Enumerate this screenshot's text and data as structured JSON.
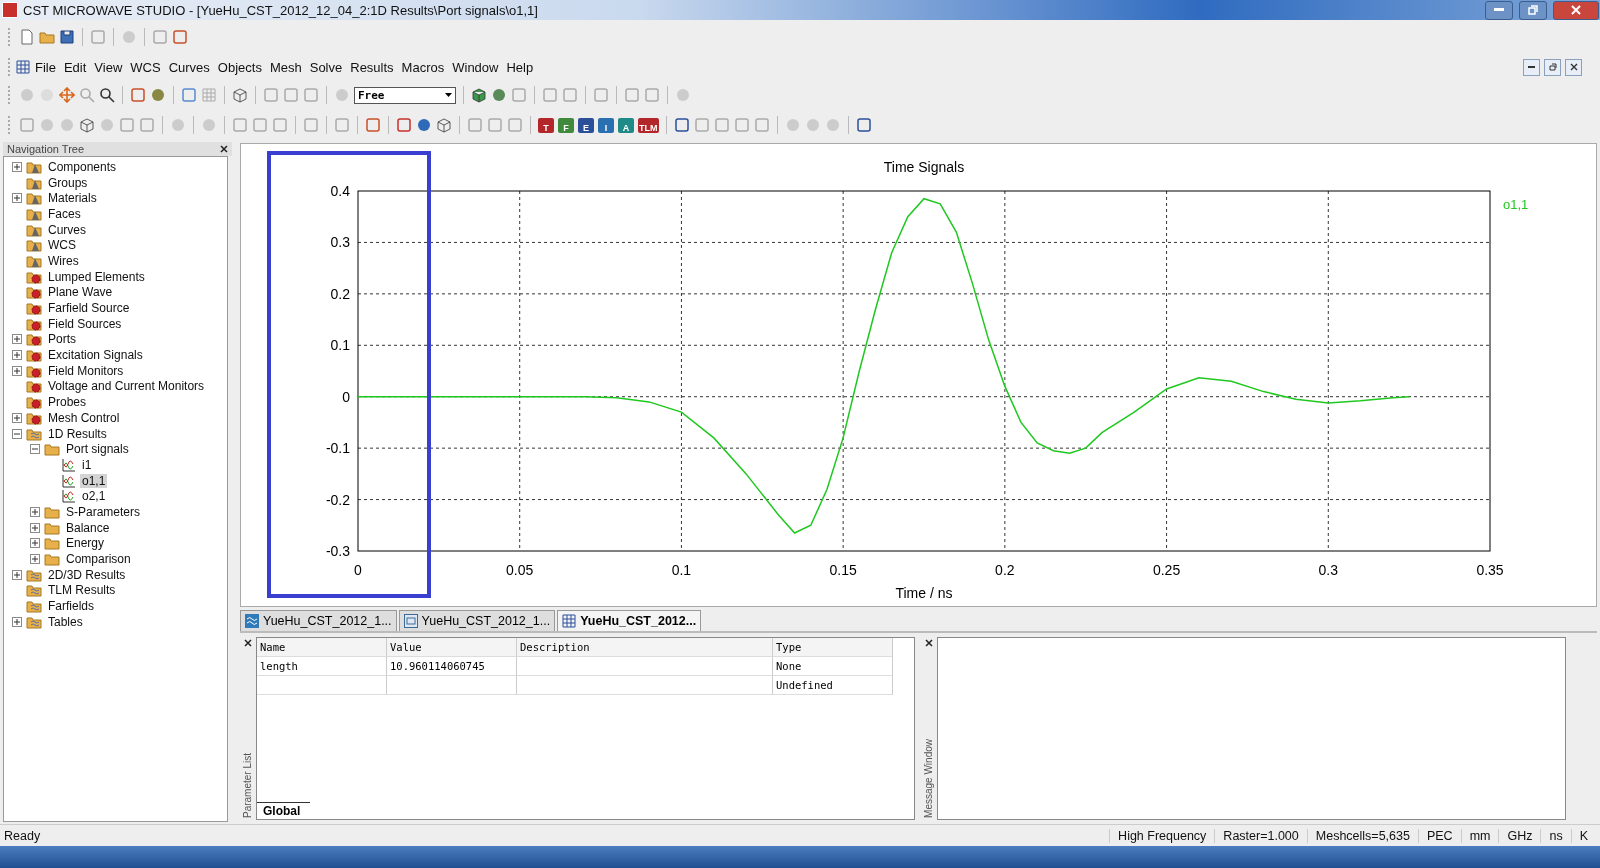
{
  "window": {
    "title": "CST MICROWAVE STUDIO - [YueHu_CST_2012_12_04_2:1D Results\\Port signals\\o1,1]"
  },
  "menu": [
    "File",
    "Edit",
    "View",
    "WCS",
    "Curves",
    "Objects",
    "Mesh",
    "Solve",
    "Results",
    "Macros",
    "Window",
    "Help"
  ],
  "toolbar": {
    "mode_dropdown": "Free",
    "solver_buttons": [
      {
        "label": "T",
        "color": "#b3272a"
      },
      {
        "label": "F",
        "color": "#3f8a3c"
      },
      {
        "label": "E",
        "color": "#2c4f9a"
      },
      {
        "label": "I",
        "color": "#2a6fb0"
      },
      {
        "label": "A",
        "color": "#1f8a86"
      },
      {
        "label": "TLM",
        "color": "#b3272a"
      }
    ]
  },
  "navigation_tree": {
    "title": "Navigation Tree",
    "items": [
      {
        "label": "Components",
        "kind": "model",
        "expanded": false,
        "selected": false
      },
      {
        "label": "Groups",
        "kind": "model",
        "selected": false
      },
      {
        "label": "Materials",
        "kind": "model",
        "expanded": false,
        "selected": false
      },
      {
        "label": "Faces",
        "kind": "model",
        "selected": false
      },
      {
        "label": "Curves",
        "kind": "model",
        "selected": false
      },
      {
        "label": "WCS",
        "kind": "model",
        "selected": false
      },
      {
        "label": "Wires",
        "kind": "model",
        "selected": false
      },
      {
        "label": "Lumped Elements",
        "kind": "source",
        "selected": false
      },
      {
        "label": "Plane Wave",
        "kind": "source",
        "selected": false
      },
      {
        "label": "Farfield Source",
        "kind": "source",
        "selected": false
      },
      {
        "label": "Field Sources",
        "kind": "source",
        "selected": false
      },
      {
        "label": "Ports",
        "kind": "source",
        "expanded": false,
        "selected": false
      },
      {
        "label": "Excitation Signals",
        "kind": "source",
        "expanded": false,
        "selected": false
      },
      {
        "label": "Field Monitors",
        "kind": "source",
        "expanded": false,
        "selected": false
      },
      {
        "label": "Voltage and Current Monitors",
        "kind": "source",
        "selected": false
      },
      {
        "label": "Probes",
        "kind": "source",
        "selected": false
      },
      {
        "label": "Mesh Control",
        "kind": "source",
        "expanded": false,
        "selected": false
      },
      {
        "label": "1D Results",
        "kind": "result",
        "expanded": true,
        "selected": false,
        "children": [
          {
            "label": "Port signals",
            "kind": "folder",
            "expanded": true,
            "selected": false,
            "children": [
              {
                "label": "i1",
                "kind": "signal",
                "selected": false
              },
              {
                "label": "o1,1",
                "kind": "signal",
                "selected": true
              },
              {
                "label": "o2,1",
                "kind": "signal",
                "selected": false
              }
            ]
          },
          {
            "label": "S-Parameters",
            "kind": "folder",
            "expanded": false,
            "selected": false
          },
          {
            "label": "Balance",
            "kind": "folder",
            "expanded": false,
            "selected": false
          },
          {
            "label": "Energy",
            "kind": "folder",
            "expanded": false,
            "selected": false
          },
          {
            "label": "Comparison",
            "kind": "folder",
            "expanded": false,
            "selected": false
          }
        ]
      },
      {
        "label": "2D/3D Results",
        "kind": "result",
        "expanded": false,
        "selected": false
      },
      {
        "label": "TLM Results",
        "kind": "result",
        "selected": false
      },
      {
        "label": "Farfields",
        "kind": "result",
        "selected": false
      },
      {
        "label": "Tables",
        "kind": "result",
        "expanded": false,
        "selected": false
      }
    ]
  },
  "chart": {
    "chart_data": {
      "type": "line",
      "title": "Time Signals",
      "xlabel": "Time / ns",
      "xlim": [
        0,
        0.35
      ],
      "ylim": [
        -0.3,
        0.4
      ],
      "xticks": [
        0,
        0.05,
        0.1,
        0.15,
        0.2,
        0.25,
        0.3,
        0.35
      ],
      "yticks": [
        -0.3,
        -0.2,
        -0.1,
        0,
        0.1,
        0.2,
        0.3,
        0.4
      ],
      "x": [
        0,
        0.05,
        0.07,
        0.08,
        0.09,
        0.1,
        0.11,
        0.12,
        0.13,
        0.135,
        0.14,
        0.145,
        0.15,
        0.155,
        0.16,
        0.165,
        0.17,
        0.175,
        0.18,
        0.185,
        0.19,
        0.195,
        0.2,
        0.205,
        0.21,
        0.215,
        0.22,
        0.225,
        0.23,
        0.24,
        0.25,
        0.26,
        0.27,
        0.28,
        0.29,
        0.3,
        0.31,
        0.32,
        0.325
      ],
      "series": [
        {
          "name": "o1,1",
          "color": "#1fc81f",
          "values": [
            0,
            0,
            0,
            -0.002,
            -0.01,
            -0.03,
            -0.08,
            -0.15,
            -0.23,
            -0.265,
            -0.25,
            -0.18,
            -0.08,
            0.05,
            0.17,
            0.28,
            0.35,
            0.385,
            0.375,
            0.32,
            0.22,
            0.11,
            0.02,
            -0.05,
            -0.09,
            -0.105,
            -0.11,
            -0.1,
            -0.07,
            -0.03,
            0.015,
            0.037,
            0.03,
            0.01,
            -0.005,
            -0.012,
            -0.008,
            -0.002,
            0
          ]
        }
      ],
      "grid": true
    },
    "highlight": {
      "color": "#3a3fcf"
    }
  },
  "document_tabs": [
    {
      "label": "YueHu_CST_2012_1...",
      "kind": "plot",
      "selected": false
    },
    {
      "label": "YueHu_CST_2012_1...",
      "kind": "model",
      "selected": false
    },
    {
      "label": "YueHu_CST_2012...",
      "kind": "table",
      "selected": true
    }
  ],
  "parameter_list": {
    "side_title": "Parameter List",
    "columns": [
      "Name",
      "Value",
      "Description",
      "Type"
    ],
    "rows": [
      [
        "length",
        "10.960114060745",
        "",
        "None"
      ],
      [
        "",
        "",
        "",
        "Undefined"
      ]
    ],
    "tabs": [
      {
        "label": "Global",
        "selected": true
      }
    ]
  },
  "message_window": {
    "side_title": "Message Window"
  },
  "status_bar": {
    "message": "Ready",
    "fields": [
      "High Frequency",
      "Raster=1.000",
      "Meshcells=5,635",
      "PEC",
      "mm",
      "GHz",
      "ns",
      "K"
    ]
  }
}
